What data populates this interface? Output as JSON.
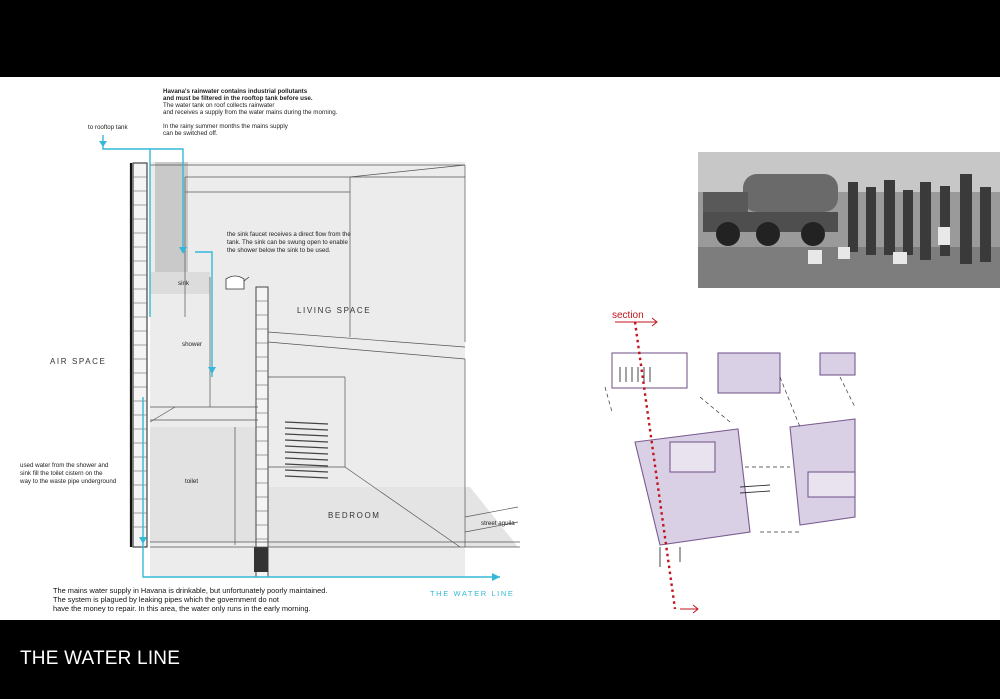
{
  "page": {
    "footer_title": "THE WATER LINE"
  },
  "annotations": {
    "rainwater_1": "Havana's rainwater contains industrial pollutants",
    "rainwater_2": "and must be filtered in the rooftop tank before use.",
    "tank_1": "The water tank on roof collects rainwater",
    "tank_2": "and receives a supply from the water mains during the morning.",
    "summer_1": "In the rainy summer months the mains supply",
    "summer_2": "can be switched off.",
    "rooftop_tank": "to rooftop tank",
    "faucet_1": "the sink faucet receives a direct flow from the",
    "faucet_2": "tank. The sink can be swung open to enable",
    "faucet_3": "the shower below the sink to be used.",
    "used_1": "used water from the shower and",
    "used_2": "sink fill the toilet cistern on the",
    "used_3": "way to the waste pipe underground",
    "street": "street aguila",
    "mains_1": "The mains water supply in Havana is drinkable, but unfortunately poorly maintained.",
    "mains_2": "The system is plagued by leaking pipes which the government do not",
    "mains_3": "have the money to repair. In this area, the water only runs in the early morning."
  },
  "rooms": {
    "air_space": "AIR SPACE",
    "living_space": "LIVING SPACE",
    "bedroom": "BEDROOM",
    "sink": "sink",
    "shower": "shower",
    "toilet": "toilet"
  },
  "diagram": {
    "water_line_label": "THE WATER LINE",
    "section_label": "section",
    "water_color": "#35b8d8",
    "section_color": "#c0151d",
    "plan_fill": "#d9d0e6",
    "plan_stroke": "#7a5c8f"
  }
}
